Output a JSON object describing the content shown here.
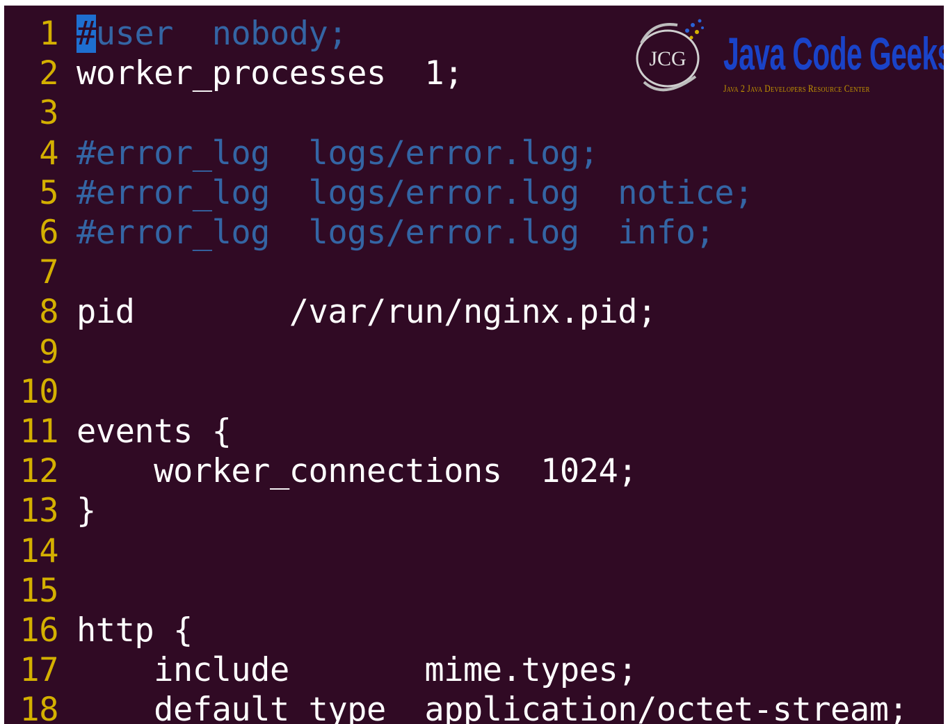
{
  "editor": {
    "lines": [
      {
        "number": "1",
        "cursor_char": "#",
        "text": "user  nobody;",
        "style": "comment"
      },
      {
        "number": "2",
        "text": "worker_processes  1;",
        "style": "normal"
      },
      {
        "number": "3",
        "text": "",
        "style": "normal"
      },
      {
        "number": "4",
        "text": "#error_log  logs/error.log;",
        "style": "comment"
      },
      {
        "number": "5",
        "text": "#error_log  logs/error.log  notice;",
        "style": "comment"
      },
      {
        "number": "6",
        "text": "#error_log  logs/error.log  info;",
        "style": "comment"
      },
      {
        "number": "7",
        "text": "",
        "style": "normal"
      },
      {
        "number": "8",
        "text": "pid        /var/run/nginx.pid;",
        "style": "normal"
      },
      {
        "number": "9",
        "text": "",
        "style": "normal"
      },
      {
        "number": "10",
        "text": "",
        "style": "normal"
      },
      {
        "number": "11",
        "text": "events {",
        "style": "normal"
      },
      {
        "number": "12",
        "text": "    worker_connections  1024;",
        "style": "normal"
      },
      {
        "number": "13",
        "text": "}",
        "style": "normal"
      },
      {
        "number": "14",
        "text": "",
        "style": "normal"
      },
      {
        "number": "15",
        "text": "",
        "style": "normal"
      },
      {
        "number": "16",
        "text": "http {",
        "style": "normal"
      },
      {
        "number": "17",
        "text": "    include       mime.types;",
        "style": "normal"
      },
      {
        "number": "18",
        "text": "    default_type  application/octet-stream;",
        "style": "normal"
      }
    ]
  },
  "watermark": {
    "emblem_text": "JCG",
    "title": "Java Code Geeks",
    "subtitle": "Java 2 Java Developers Resource Center"
  },
  "colors": {
    "background": "#300a24",
    "line_number": "#d4b000",
    "text": "#ffffff",
    "comment": "#3465a4",
    "cursor": "#1e6fd0",
    "logo_blue": "#1a43c8",
    "logo_gold": "#c29400"
  }
}
